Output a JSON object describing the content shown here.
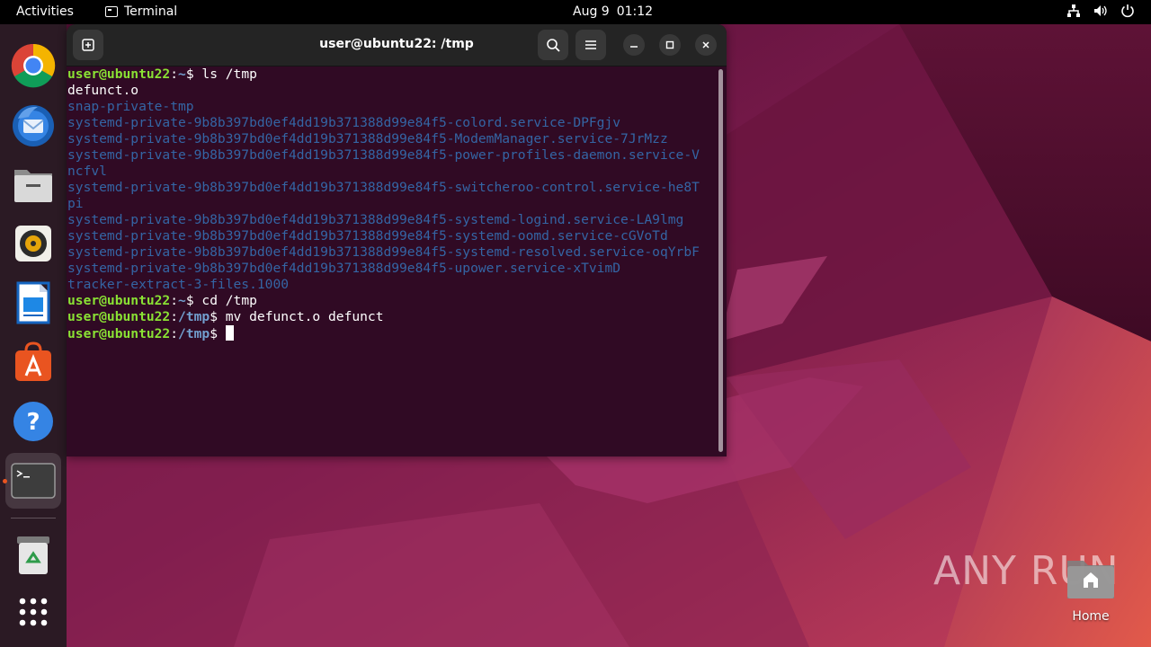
{
  "topbar": {
    "activities": "Activities",
    "app_name": "Terminal",
    "date": "Aug 9",
    "time": "01:12"
  },
  "dock": {
    "items": [
      {
        "name": "chrome"
      },
      {
        "name": "thunderbird"
      },
      {
        "name": "files"
      },
      {
        "name": "rhythmbox"
      },
      {
        "name": "libreoffice-writer"
      },
      {
        "name": "app-center"
      },
      {
        "name": "help"
      },
      {
        "name": "terminal",
        "active": true
      },
      {
        "name": "trash"
      },
      {
        "name": "show-apps"
      }
    ]
  },
  "window": {
    "title": "user@ubuntu22: /tmp"
  },
  "terminal": {
    "lines": [
      {
        "user": "user@ubuntu22",
        "path": "~",
        "cmd": " ls /tmp"
      },
      {
        "text": "defunct.o",
        "kind": "file"
      },
      {
        "text": "snap-private-tmp",
        "kind": "dir"
      },
      {
        "text": "systemd-private-9b8b397bd0ef4dd19b371388d99e84f5-colord.service-DPFgjv",
        "kind": "dir"
      },
      {
        "text": "systemd-private-9b8b397bd0ef4dd19b371388d99e84f5-ModemManager.service-7JrMzz",
        "kind": "dir"
      },
      {
        "text": "systemd-private-9b8b397bd0ef4dd19b371388d99e84f5-power-profiles-daemon.service-V",
        "kind": "dir"
      },
      {
        "text": "ncfvl",
        "kind": "dir"
      },
      {
        "text": "systemd-private-9b8b397bd0ef4dd19b371388d99e84f5-switcheroo-control.service-he8T",
        "kind": "dir"
      },
      {
        "text": "pi",
        "kind": "dir"
      },
      {
        "text": "systemd-private-9b8b397bd0ef4dd19b371388d99e84f5-systemd-logind.service-LA9lmg",
        "kind": "dir"
      },
      {
        "text": "systemd-private-9b8b397bd0ef4dd19b371388d99e84f5-systemd-oomd.service-cGVoTd",
        "kind": "dir"
      },
      {
        "text": "systemd-private-9b8b397bd0ef4dd19b371388d99e84f5-systemd-resolved.service-oqYrbF",
        "kind": "dir"
      },
      {
        "text": "systemd-private-9b8b397bd0ef4dd19b371388d99e84f5-upower.service-xTvimD",
        "kind": "dir"
      },
      {
        "text": "tracker-extract-3-files.1000",
        "kind": "dir"
      },
      {
        "user": "user@ubuntu22",
        "path": "~",
        "cmd": " cd /tmp"
      },
      {
        "user": "user@ubuntu22",
        "path": "/tmp",
        "cmd": " mv defunct.o defunct"
      },
      {
        "user": "user@ubuntu22",
        "path": "/tmp",
        "cmd": " ",
        "cursor": true
      }
    ]
  },
  "desktop": {
    "home_label": "Home",
    "watermark": "ANY RUN"
  }
}
